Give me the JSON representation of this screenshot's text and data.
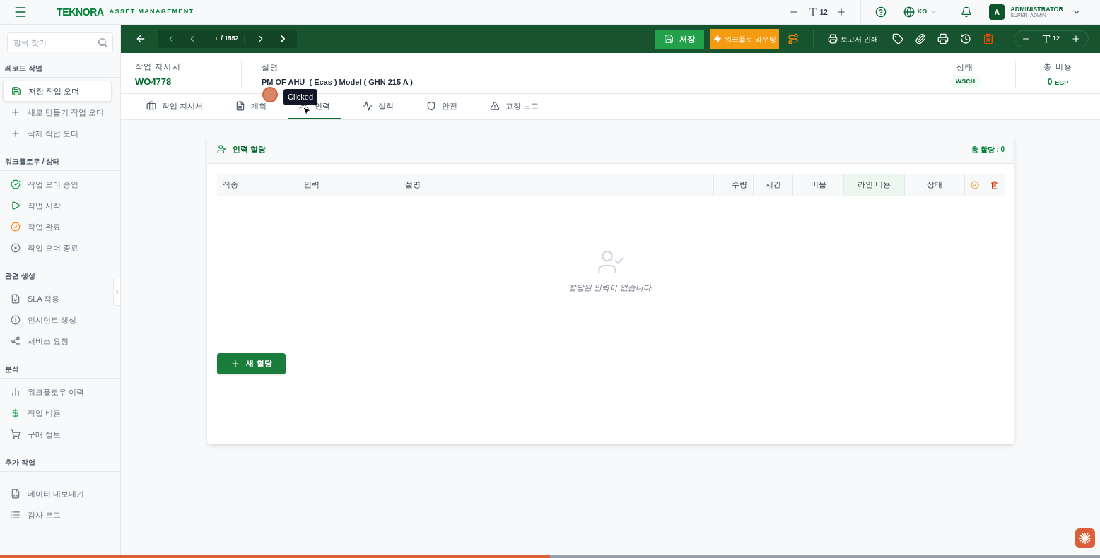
{
  "topbar": {
    "logo": "TEKNORA",
    "subtitle": "ASSET MANAGEMENT",
    "font_size": "12",
    "language": "KO",
    "user": {
      "avatar": "A",
      "name": "ADMINISTRATOR",
      "role": "SUPER_ADMIN"
    }
  },
  "sidebar": {
    "search": {
      "placeholder": "항목 찾기"
    },
    "sections": [
      {
        "title": "레코드 작업",
        "items": [
          {
            "label": "저장 작업 오더",
            "selected": true
          },
          {
            "label": "새로 만들기 작업 오더",
            "selected": false
          },
          {
            "label": "삭제 작업 오더",
            "selected": false
          }
        ]
      },
      {
        "title": "워크플로우 / 상태",
        "items": [
          {
            "label": "작업 오더 승인",
            "selected": false
          },
          {
            "label": "작업 시작",
            "selected": false
          },
          {
            "label": "작업 완료",
            "selected": false
          },
          {
            "label": "작업 오더 종료",
            "selected": false
          }
        ]
      },
      {
        "title": "관련 생성",
        "items": [
          {
            "label": "SLA 적용",
            "selected": false
          },
          {
            "label": "인시던트 생성",
            "selected": false
          },
          {
            "label": "서비스 요청",
            "selected": false
          }
        ]
      },
      {
        "title": "분석",
        "items": [
          {
            "label": "워크플로우 이력",
            "selected": false
          },
          {
            "label": "작업 비용",
            "selected": false
          },
          {
            "label": "구매 정보",
            "selected": false
          }
        ]
      },
      {
        "title": "추가 작업",
        "items": [
          {
            "label": "데이터 내보내기",
            "selected": false
          },
          {
            "label": "감사 로그",
            "selected": false
          }
        ]
      }
    ]
  },
  "toolbar": {
    "page": "1",
    "total": "/ 1552",
    "save": "저장",
    "workflow": "워크플로 라우팅",
    "print_report": "보고서 인쇄",
    "font_size": "12"
  },
  "header": {
    "fields": [
      {
        "label": "작업 지시서",
        "value": "WO4778",
        "kind": "id"
      },
      {
        "label": "설명",
        "value": "PM OF AHU  ( Ecas ) Model ( GHN 215 A )",
        "kind": "text"
      },
      {
        "label": "상태",
        "value": "WSCH",
        "kind": "badge"
      },
      {
        "label": "총 비용",
        "value": "0",
        "unit": "EGP",
        "kind": "money"
      }
    ]
  },
  "tabs": [
    {
      "label": "작업 지시서",
      "selected": false
    },
    {
      "label": "계획",
      "selected": false
    },
    {
      "label": "인력",
      "selected": true
    },
    {
      "label": "실적",
      "selected": false
    },
    {
      "label": "안전",
      "selected": false
    },
    {
      "label": "고장 보고",
      "selected": false
    }
  ],
  "tooltip": "Clicked",
  "labor": {
    "title": "인력 할당",
    "total": "총 할당 : 0",
    "columns": [
      "직종",
      "인력",
      "설명",
      "수량",
      "시간",
      "비율",
      "라인 비용",
      "상태"
    ],
    "empty": "할당된 인력이 없습니다.",
    "add_button": "새 할당"
  },
  "progress": {
    "level": 0.5
  }
}
